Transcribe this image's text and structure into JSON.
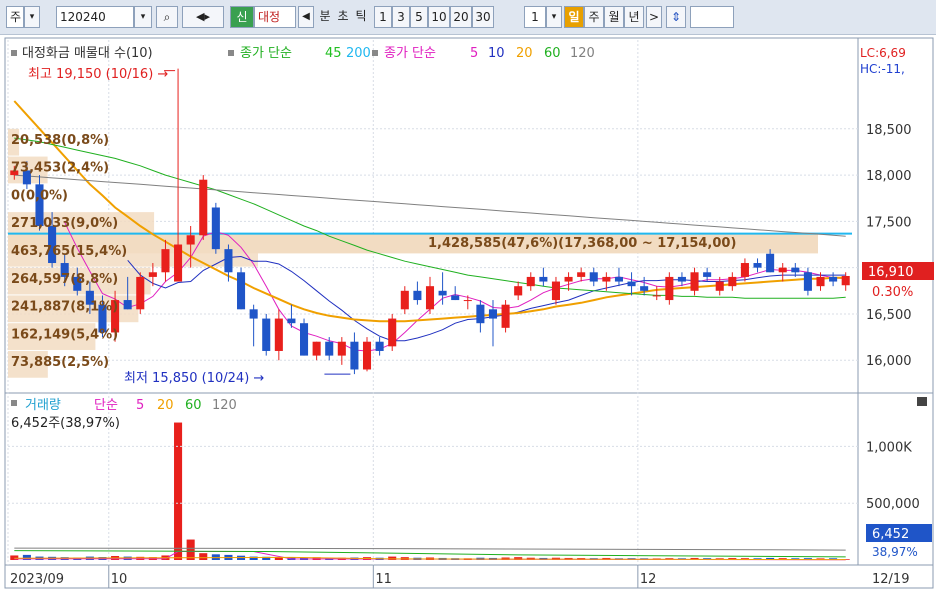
{
  "toolbar": {
    "market": "주",
    "code": "120240",
    "new_badge": "신",
    "name": "대정",
    "periods": [
      "분",
      "초",
      "틱"
    ],
    "intervals": [
      "1",
      "3",
      "5",
      "10",
      "20",
      "30"
    ],
    "interval_value": "1",
    "day_tab": "일",
    "week_tab": "주",
    "month_tab": "월",
    "year_tab": "년",
    "next_label": ">"
  },
  "price_panel": {
    "legend": {
      "volume_profile": "대정화금 매물대 수(10)",
      "ma_long_label": "종가 단순",
      "ma_long_periods": [
        "45",
        "200"
      ],
      "ma_short_label": "종가 단순",
      "ma_short_periods": [
        "5",
        "10",
        "20",
        "60",
        "120"
      ]
    },
    "corner_labels": [
      "LC:6,69",
      "HC:-11,"
    ],
    "high_note": "최고 19,150 (10/16) →",
    "low_note": "최저 15,850 (10/24) →",
    "current_price": "16,910",
    "current_change": "0.30%",
    "band_label": "1,428,585(47,6%)(17,368,00 ~ 17,154,00)",
    "profile_labels": [
      "20,538(0,8%)",
      "73,453(2,4%)",
      "0(0,0%)",
      "271,033(9,0%)",
      "463,765(15,4%)",
      "264,597(8,8%)",
      "241,887(8,1%)",
      "162,149(5,4%)",
      "73,885(2,5%)"
    ]
  },
  "volume_panel": {
    "legend": {
      "title": "거래량",
      "ma_label": "단순",
      "ma_periods": [
        "5",
        "20",
        "60",
        "120"
      ]
    },
    "current_label": "6,452주(38,97%)",
    "current_value": "6,452",
    "current_pct": "38,97%"
  },
  "colors": {
    "up": "#e8201c",
    "down": "#1f55c8",
    "ma5": "#e020c0",
    "ma10": "#2030c0",
    "ma20": "#f0a000",
    "ma60": "#20b020",
    "ma45": "#22c022",
    "ma200": "#20b8f0",
    "ma120": "#808080",
    "band": "#f2dcc2",
    "cyan_line": "#20b8f0"
  },
  "chart_data": {
    "type": "candlestick",
    "x_labels": [
      "2023/09",
      "10",
      "11",
      "12",
      "12/19"
    ],
    "y_ticks": [
      16000,
      16500,
      17000,
      17500,
      18000,
      18500
    ],
    "ylim": [
      15700,
      19200
    ],
    "volume_ticks": [
      "500,000",
      "1,000K"
    ],
    "volume_ylim": [
      0,
      1250000
    ],
    "candles": [
      {
        "o": 18000,
        "h": 18100,
        "l": 17950,
        "c": 18050
      },
      {
        "o": 18050,
        "h": 18150,
        "l": 17850,
        "c": 17900
      },
      {
        "o": 17900,
        "h": 18000,
        "l": 17400,
        "c": 17450
      },
      {
        "o": 17450,
        "h": 17600,
        "l": 17000,
        "c": 17050
      },
      {
        "o": 17050,
        "h": 17150,
        "l": 16800,
        "c": 16900
      },
      {
        "o": 16900,
        "h": 17000,
        "l": 16700,
        "c": 16750
      },
      {
        "o": 16750,
        "h": 16850,
        "l": 16500,
        "c": 16600
      },
      {
        "o": 16600,
        "h": 16700,
        "l": 16250,
        "c": 16300
      },
      {
        "o": 16300,
        "h": 16750,
        "l": 16200,
        "c": 16650
      },
      {
        "o": 16650,
        "h": 16900,
        "l": 16550,
        "c": 16550
      },
      {
        "o": 16550,
        "h": 16950,
        "l": 16500,
        "c": 16900
      },
      {
        "o": 16900,
        "h": 17050,
        "l": 16800,
        "c": 16950
      },
      {
        "o": 16950,
        "h": 17300,
        "l": 16850,
        "c": 17200
      },
      {
        "o": 16850,
        "h": 19150,
        "l": 16850,
        "c": 17250
      },
      {
        "o": 17250,
        "h": 17450,
        "l": 17000,
        "c": 17350
      },
      {
        "o": 17350,
        "h": 18000,
        "l": 17300,
        "c": 17950
      },
      {
        "o": 17650,
        "h": 17700,
        "l": 17150,
        "c": 17200
      },
      {
        "o": 17200,
        "h": 17250,
        "l": 16850,
        "c": 16950
      },
      {
        "o": 16950,
        "h": 17000,
        "l": 16550,
        "c": 16550
      },
      {
        "o": 16550,
        "h": 16600,
        "l": 16150,
        "c": 16450
      },
      {
        "o": 16450,
        "h": 16500,
        "l": 16050,
        "c": 16100
      },
      {
        "o": 16100,
        "h": 16550,
        "l": 16000,
        "c": 16450
      },
      {
        "o": 16450,
        "h": 16600,
        "l": 16350,
        "c": 16400
      },
      {
        "o": 16400,
        "h": 16450,
        "l": 16050,
        "c": 16050
      },
      {
        "o": 16050,
        "h": 16200,
        "l": 16000,
        "c": 16200
      },
      {
        "o": 16200,
        "h": 16250,
        "l": 16000,
        "c": 16050
      },
      {
        "o": 16050,
        "h": 16250,
        "l": 15950,
        "c": 16200
      },
      {
        "o": 16200,
        "h": 16300,
        "l": 15850,
        "c": 15900
      },
      {
        "o": 15900,
        "h": 16250,
        "l": 15880,
        "c": 16200
      },
      {
        "o": 16200,
        "h": 16250,
        "l": 16050,
        "c": 16100
      },
      {
        "o": 16150,
        "h": 16500,
        "l": 16100,
        "c": 16450
      },
      {
        "o": 16550,
        "h": 16800,
        "l": 16500,
        "c": 16750
      },
      {
        "o": 16750,
        "h": 16850,
        "l": 16600,
        "c": 16650
      },
      {
        "o": 16550,
        "h": 16900,
        "l": 16500,
        "c": 16800
      },
      {
        "o": 16750,
        "h": 16950,
        "l": 16600,
        "c": 16700
      },
      {
        "o": 16700,
        "h": 16800,
        "l": 16650,
        "c": 16650
      },
      {
        "o": 16650,
        "h": 16700,
        "l": 16550,
        "c": 16650
      },
      {
        "o": 16600,
        "h": 16650,
        "l": 16300,
        "c": 16400
      },
      {
        "o": 16550,
        "h": 16650,
        "l": 16150,
        "c": 16450
      },
      {
        "o": 16350,
        "h": 16650,
        "l": 16300,
        "c": 16600
      },
      {
        "o": 16700,
        "h": 16850,
        "l": 16650,
        "c": 16800
      },
      {
        "o": 16800,
        "h": 16950,
        "l": 16750,
        "c": 16900
      },
      {
        "o": 16900,
        "h": 17000,
        "l": 16800,
        "c": 16850
      },
      {
        "o": 16650,
        "h": 16900,
        "l": 16600,
        "c": 16850
      },
      {
        "o": 16850,
        "h": 16950,
        "l": 16750,
        "c": 16900
      },
      {
        "o": 16900,
        "h": 17000,
        "l": 16850,
        "c": 16950
      },
      {
        "o": 16950,
        "h": 17000,
        "l": 16800,
        "c": 16850
      },
      {
        "o": 16850,
        "h": 16950,
        "l": 16750,
        "c": 16900
      },
      {
        "o": 16900,
        "h": 17000,
        "l": 16800,
        "c": 16850
      },
      {
        "o": 16850,
        "h": 16950,
        "l": 16700,
        "c": 16800
      },
      {
        "o": 16800,
        "h": 16900,
        "l": 16700,
        "c": 16750
      },
      {
        "o": 16700,
        "h": 16800,
        "l": 16650,
        "c": 16700
      },
      {
        "o": 16650,
        "h": 16950,
        "l": 16600,
        "c": 16900
      },
      {
        "o": 16900,
        "h": 16950,
        "l": 16800,
        "c": 16850
      },
      {
        "o": 16750,
        "h": 17000,
        "l": 16700,
        "c": 16950
      },
      {
        "o": 16950,
        "h": 17000,
        "l": 16850,
        "c": 16900
      },
      {
        "o": 16750,
        "h": 16900,
        "l": 16700,
        "c": 16850
      },
      {
        "o": 16800,
        "h": 16950,
        "l": 16750,
        "c": 16900
      },
      {
        "o": 16900,
        "h": 17100,
        "l": 16850,
        "c": 17050
      },
      {
        "o": 17050,
        "h": 17100,
        "l": 16950,
        "c": 17000
      },
      {
        "o": 17150,
        "h": 17200,
        "l": 16950,
        "c": 16950
      },
      {
        "o": 16950,
        "h": 17050,
        "l": 16850,
        "c": 17000
      },
      {
        "o": 17000,
        "h": 17050,
        "l": 16900,
        "c": 16950
      },
      {
        "o": 16950,
        "h": 17000,
        "l": 16700,
        "c": 16750
      },
      {
        "o": 16800,
        "h": 16950,
        "l": 16750,
        "c": 16900
      },
      {
        "o": 16900,
        "h": 16950,
        "l": 16800,
        "c": 16850
      },
      {
        "o": 16810,
        "h": 16950,
        "l": 16750,
        "c": 16910
      }
    ],
    "volumes": [
      40000,
      45000,
      30000,
      28000,
      25000,
      22000,
      30000,
      26000,
      35000,
      30000,
      28000,
      25000,
      40000,
      1210000,
      180000,
      60000,
      50000,
      45000,
      38000,
      30000,
      28000,
      25000,
      22000,
      20000,
      24000,
      18000,
      20000,
      22000,
      25000,
      20000,
      30000,
      25000,
      20000,
      22000,
      18000,
      16000,
      15000,
      20000,
      18000,
      22000,
      25000,
      20000,
      18000,
      20000,
      18000,
      17000,
      16000,
      18000,
      15000,
      16000,
      15000,
      14000,
      16000,
      15000,
      18000,
      16000,
      15000,
      17000,
      16000,
      15000,
      18000,
      16000,
      15000,
      16000,
      14000,
      15000,
      6452
    ],
    "series": [
      {
        "name": "5",
        "values": [
          null,
          null,
          null,
          null,
          17490,
          17210,
          16960,
          16720,
          16660,
          16570,
          16610,
          16690,
          16850,
          16950,
          17110,
          17340,
          17390,
          17350,
          17220,
          17040,
          16800,
          16550,
          16370,
          16300,
          16260,
          16210,
          16180,
          16110,
          16100,
          16120,
          16180,
          16300,
          16430,
          16550,
          16670,
          16710,
          16680,
          16640,
          16570,
          16560,
          16580,
          16650,
          16730,
          16780,
          16820,
          16860,
          16880,
          16880,
          16900,
          16870,
          16840,
          16800,
          16790,
          16810,
          16840,
          16870,
          16870,
          16880,
          16900,
          16940,
          16980,
          16970,
          16970,
          16950,
          16920,
          16890,
          16880
        ]
      },
      {
        "name": "10",
        "values": [
          null,
          null,
          null,
          null,
          null,
          null,
          null,
          null,
          null,
          17080,
          16920,
          16830,
          16780,
          16840,
          16850,
          16970,
          17040,
          17110,
          17120,
          17070,
          17070,
          17040,
          16960,
          16860,
          16750,
          16640,
          16540,
          16430,
          16340,
          16260,
          16210,
          16210,
          16240,
          16280,
          16330,
          16400,
          16440,
          16450,
          16470,
          16490,
          16520,
          16560,
          16590,
          16620,
          16650,
          16700,
          16750,
          16780,
          16810,
          16840,
          16860,
          16860,
          16870,
          16870,
          16860,
          16850,
          16850,
          16860,
          16870,
          16890,
          16910,
          16920,
          16920,
          16920,
          16920,
          16920,
          16920
        ]
      },
      {
        "name": "20",
        "values": [
          18800,
          18650,
          18500,
          18350,
          18200,
          18050,
          17900,
          17780,
          17650,
          17550,
          17450,
          17360,
          17280,
          17200,
          17120,
          17050,
          16980,
          16910,
          16850,
          16780,
          16720,
          16660,
          16600,
          16550,
          16510,
          16480,
          16460,
          16440,
          16430,
          16420,
          16420,
          16420,
          16430,
          16440,
          16450,
          16460,
          16470,
          16480,
          16490,
          16500,
          16510,
          16530,
          16550,
          16580,
          16600,
          16620,
          16650,
          16680,
          16700,
          16720,
          16740,
          16760,
          16770,
          16780,
          16790,
          16800,
          16810,
          16820,
          16830,
          16840,
          16850,
          16860,
          16870,
          16880,
          16880,
          16890,
          16890
        ]
      },
      {
        "name": "60",
        "values": [
          18400,
          18380,
          18360,
          18330,
          18300,
          18270,
          18240,
          18210,
          18180,
          18140,
          18100,
          18050,
          18000,
          17960,
          17920,
          17880,
          17840,
          17790,
          17740,
          17690,
          17630,
          17570,
          17510,
          17450,
          17400,
          17340,
          17290,
          17240,
          17190,
          17150,
          17110,
          17070,
          17040,
          17010,
          16980,
          16950,
          16920,
          16900,
          16880,
          16860,
          16840,
          16820,
          16800,
          16780,
          16770,
          16760,
          16750,
          16740,
          16730,
          16720,
          16710,
          16700,
          16700,
          16690,
          16690,
          16680,
          16680,
          16680,
          16670,
          16670,
          16670,
          16670,
          16670,
          16670,
          16670,
          16670,
          16680
        ]
      },
      {
        "name": "120",
        "values": [
          18000,
          17990,
          17980,
          17970,
          17960,
          17950,
          17940,
          17930,
          17920,
          17910,
          17900,
          17890,
          17880,
          17870,
          17860,
          17850,
          17840,
          17830,
          17820,
          17810,
          17800,
          17790,
          17780,
          17770,
          17760,
          17750,
          17740,
          17730,
          17720,
          17710,
          17700,
          17690,
          17680,
          17670,
          17660,
          17650,
          17640,
          17630,
          17620,
          17610,
          17600,
          17590,
          17580,
          17570,
          17560,
          17550,
          17540,
          17530,
          17520,
          17510,
          17500,
          17490,
          17480,
          17470,
          17460,
          17450,
          17440,
          17430,
          17420,
          17410,
          17400,
          17390,
          17380,
          17370,
          17360,
          17350,
          17340
        ]
      }
    ],
    "volume_profile": [
      20538,
      73453,
      0,
      271033,
      463765,
      264597,
      241887,
      162149,
      73885
    ],
    "profile_band": [
      17154,
      17368
    ],
    "reference_line": 17368
  }
}
